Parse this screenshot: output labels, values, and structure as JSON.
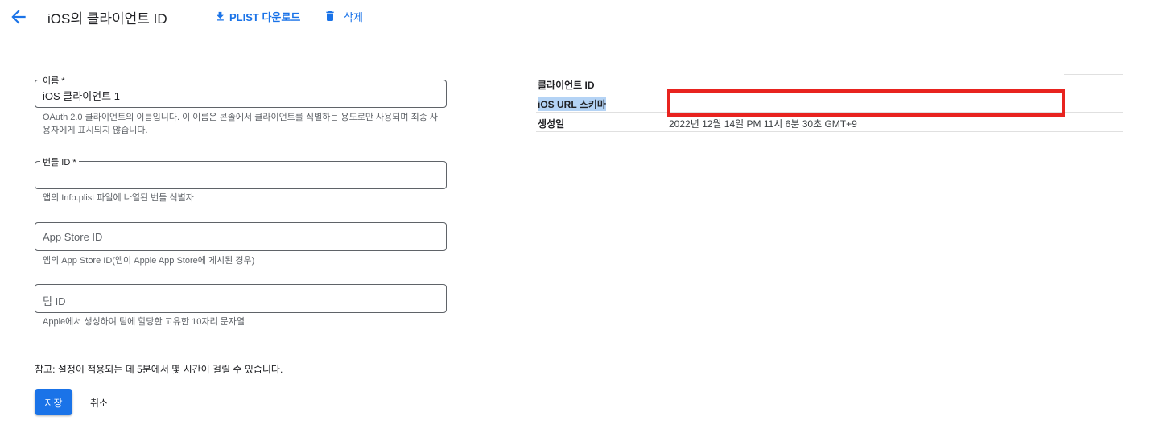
{
  "header": {
    "title": "iOS의 클라이언트 ID",
    "download_label": "PLIST 다운로드",
    "delete_label": "삭제"
  },
  "form": {
    "name": {
      "label": "이름 *",
      "value": "iOS 클라이언트 1",
      "helper": "OAuth 2.0 클라이언트의 이름입니다. 이 이름은 콘솔에서 클라이언트를 식별하는 용도로만 사용되며 최종 사용자에게 표시되지 않습니다."
    },
    "bundle_id": {
      "label": "번들 ID *",
      "value": "",
      "helper": "앱의 Info.plist 파일에 나열된 번들 식별자"
    },
    "app_store_id": {
      "placeholder": "App Store ID",
      "helper": "앱의 App Store ID(앱이 Apple App Store에 게시된 경우)"
    },
    "team_id": {
      "placeholder": "팀 ID",
      "helper": "Apple에서 생성하여 팀에 할당한 고유한 10자리 문자열"
    },
    "note": "참고: 설정이 적용되는 데 5분에서 몇 시간이 걸릴 수 있습니다.",
    "save_label": "저장",
    "cancel_label": "취소"
  },
  "info": {
    "rows": [
      {
        "key": "클라이언트 ID",
        "value": ""
      },
      {
        "key": "iOS URL 스키마",
        "value": ""
      },
      {
        "key": "생성일",
        "value": "2022년 12월 14일 PM 11시 6분 30초 GMT+9"
      }
    ]
  },
  "colors": {
    "accent": "#1a73e8",
    "highlight": "#e8231f",
    "selection": "#b4d3f5"
  },
  "icons": {
    "back": "arrow-left-icon",
    "download": "download-icon",
    "delete": "trash-icon"
  }
}
